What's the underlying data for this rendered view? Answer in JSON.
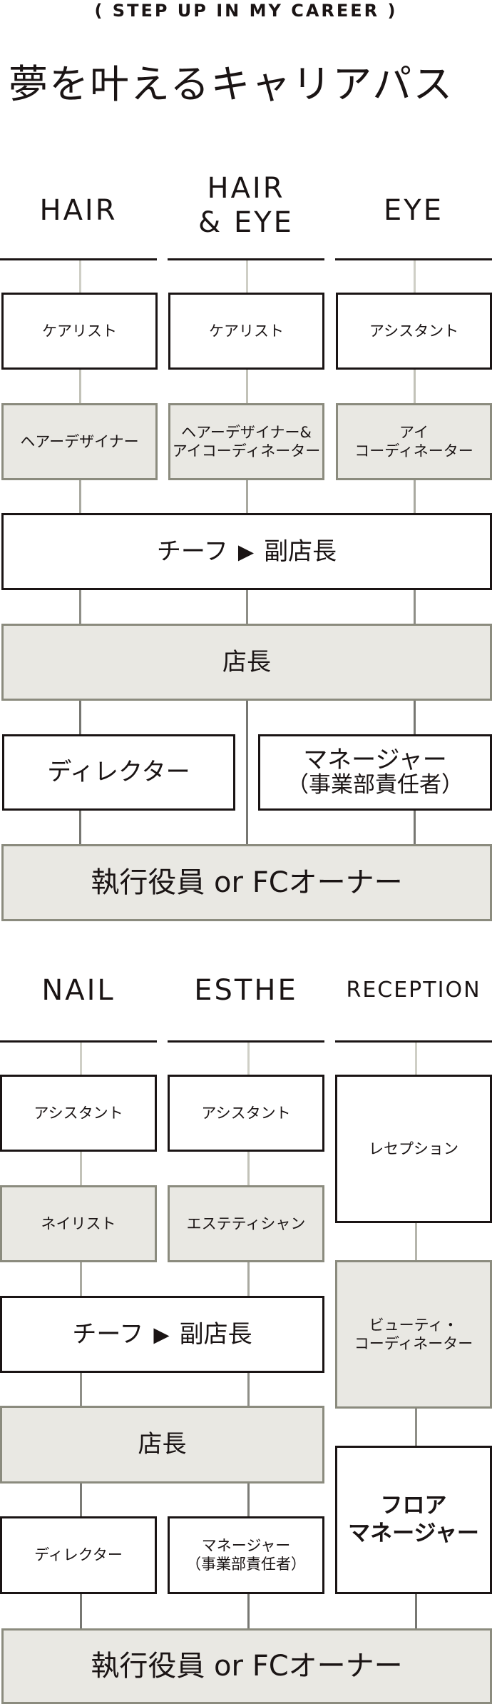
{
  "kicker": "(  STEP UP IN MY CAREER  )",
  "title": "夢を叶えるキャリアパス",
  "section1": {
    "columns": [
      "HAIR",
      "HAIR\n& EYE",
      "EYE"
    ],
    "col_hair": "HAIR",
    "col_haireye_line1": "HAIR",
    "col_haireye_line2": "& EYE",
    "col_eye": "EYE",
    "row1": [
      "ケアリスト",
      "ケアリスト",
      "アシスタント"
    ],
    "row2": {
      "hair": "ヘアーデザイナー",
      "haireye_line1": "ヘアーデザイナー&",
      "haireye_line2": "アイコーディネーター",
      "eye_line1": "アイ",
      "eye_line2": "コーディネーター"
    },
    "chief": {
      "left": "チーフ",
      "arrow": "▶",
      "right": "副店長"
    },
    "store_manager": "店長",
    "director": "ディレクター",
    "manager_line1": "マネージャー",
    "manager_line2": "（事業部責任者）",
    "executive": "執行役員 or FCオーナー"
  },
  "section2": {
    "col_nail": "NAIL",
    "col_esthe": "ESTHE",
    "col_reception": "RECEPTION",
    "nail_assistant": "アシスタント",
    "esthe_assistant": "アシスタント",
    "reception": "レセプション",
    "nailist": "ネイリスト",
    "esthetician": "エステティシャン",
    "beauty_line1": "ビューティ・",
    "beauty_line2": "コーディネーター",
    "chief": {
      "left": "チーフ",
      "arrow": "▶",
      "right": "副店長"
    },
    "store_manager": "店長",
    "floor_line1": "フロア",
    "floor_line2": "マネージャー",
    "director": "ディレクター",
    "manager_line1": "マネージャー",
    "manager_line2": "（事業部責任者）",
    "executive": "執行役員 or FCオーナー"
  },
  "colors": {
    "text": "#1a1414",
    "gray_fill": "#e9e8e3",
    "gray_border": "#8b8b7e",
    "connector_light": "#cfcfc6",
    "connector_dark": "#6f6f6a"
  }
}
